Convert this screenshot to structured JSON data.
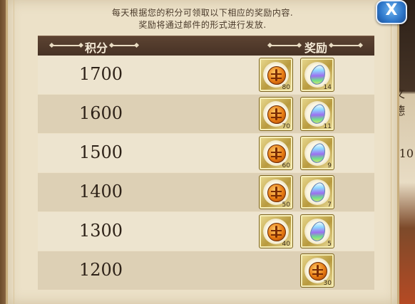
{
  "description": {
    "line1": "每天根据您的积分可领取以下相应的奖励内容.",
    "line2": "奖励将通过邮件的形式进行发放."
  },
  "close_button": {
    "label": "X"
  },
  "table": {
    "header_score": "积分",
    "header_reward": "奖励",
    "rows": [
      {
        "score": "1700",
        "rewards": [
          {
            "icon": "coin-icon",
            "count": "80"
          },
          {
            "icon": "rainbow-gem-icon",
            "count": "14"
          }
        ]
      },
      {
        "score": "1600",
        "rewards": [
          {
            "icon": "coin-icon",
            "count": "70"
          },
          {
            "icon": "rainbow-gem-icon",
            "count": "11"
          }
        ]
      },
      {
        "score": "1500",
        "rewards": [
          {
            "icon": "coin-icon",
            "count": "60"
          },
          {
            "icon": "rainbow-gem-icon",
            "count": "9"
          }
        ]
      },
      {
        "score": "1400",
        "rewards": [
          {
            "icon": "coin-icon",
            "count": "50"
          },
          {
            "icon": "rainbow-gem-icon",
            "count": "7"
          }
        ]
      },
      {
        "score": "1300",
        "rewards": [
          {
            "icon": "coin-icon",
            "count": "40"
          },
          {
            "icon": "rainbow-gem-icon",
            "count": "5"
          }
        ]
      },
      {
        "score": "1200",
        "rewards": [
          {
            "icon": "coin-icon",
            "count": "30"
          }
        ]
      }
    ]
  },
  "background_text": [
    "文德",
    "10"
  ]
}
